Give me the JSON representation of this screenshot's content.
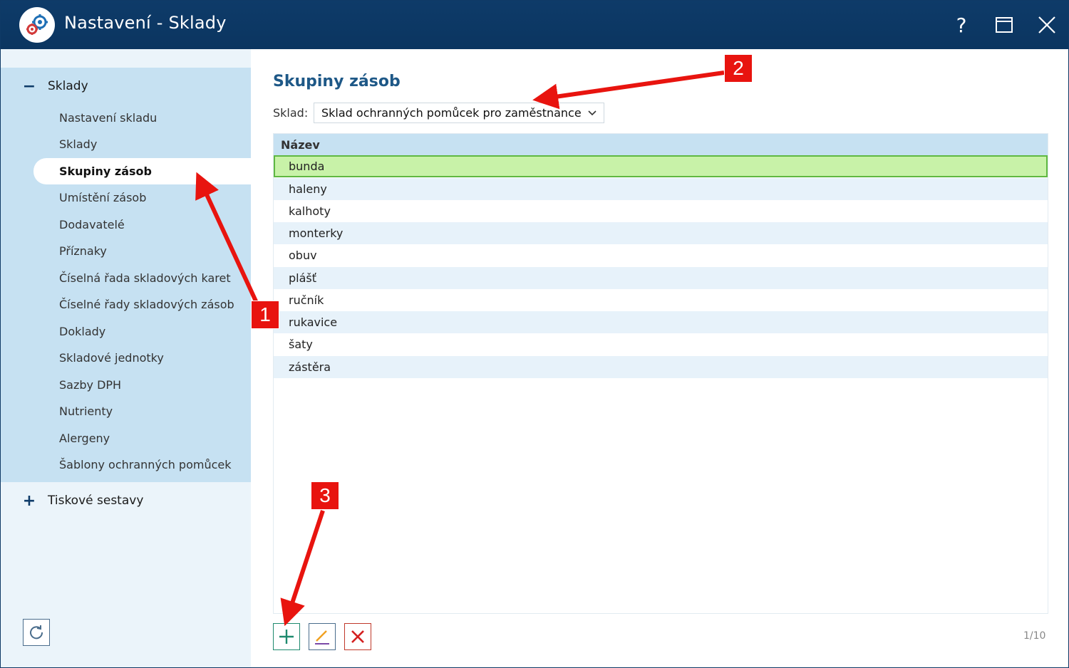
{
  "window": {
    "title": "Nastavení - Sklady",
    "help_label": "?",
    "icons": {
      "logo": "gears-icon",
      "maximize": "maximize-icon",
      "close": "close-icon"
    }
  },
  "sidebar": {
    "group_sklady": {
      "label": "Sklady",
      "expanded": true,
      "items": [
        {
          "label": "Nastavení skladu",
          "active": false
        },
        {
          "label": "Sklady",
          "active": false
        },
        {
          "label": "Skupiny zásob",
          "active": true
        },
        {
          "label": "Umístění zásob",
          "active": false
        },
        {
          "label": "Dodavatelé",
          "active": false
        },
        {
          "label": "Příznaky",
          "active": false
        },
        {
          "label": "Číselná řada skladových karet",
          "active": false
        },
        {
          "label": "Číselné řady skladových zásob",
          "active": false
        },
        {
          "label": "Doklady",
          "active": false
        },
        {
          "label": "Skladové jednotky",
          "active": false
        },
        {
          "label": "Sazby DPH",
          "active": false
        },
        {
          "label": "Nutrienty",
          "active": false
        },
        {
          "label": "Alergeny",
          "active": false
        },
        {
          "label": "Šablony ochranných pomůcek",
          "active": false
        }
      ]
    },
    "group_tiskove": {
      "label": "Tiskové sestavy",
      "expanded": false
    },
    "refresh_icon": "refresh-icon"
  },
  "main": {
    "title": "Skupiny zásob",
    "sklad_label": "Sklad:",
    "sklad_value": "Sklad ochranných pomůcek pro zaměstnance",
    "table": {
      "header": "Název",
      "rows": [
        "bunda",
        "haleny",
        "kalhoty",
        "monterky",
        "obuv",
        "plášť",
        "ručník",
        "rukavice",
        "šaty",
        "zástěra"
      ],
      "selected_index": 0
    },
    "actions": {
      "add_icon": "plus-icon",
      "edit_icon": "pencil-icon",
      "delete_icon": "delete-x-icon"
    },
    "pager": "1/10"
  },
  "annotations": {
    "badges": [
      "1",
      "2",
      "3"
    ],
    "color": "#e8140f"
  },
  "colors": {
    "titlebar": "#0e3b69",
    "sidebar_group": "#c6e1f2",
    "selected_row": "#c8f2a8",
    "selected_border": "#5fb842",
    "title_text": "#1e5887"
  }
}
